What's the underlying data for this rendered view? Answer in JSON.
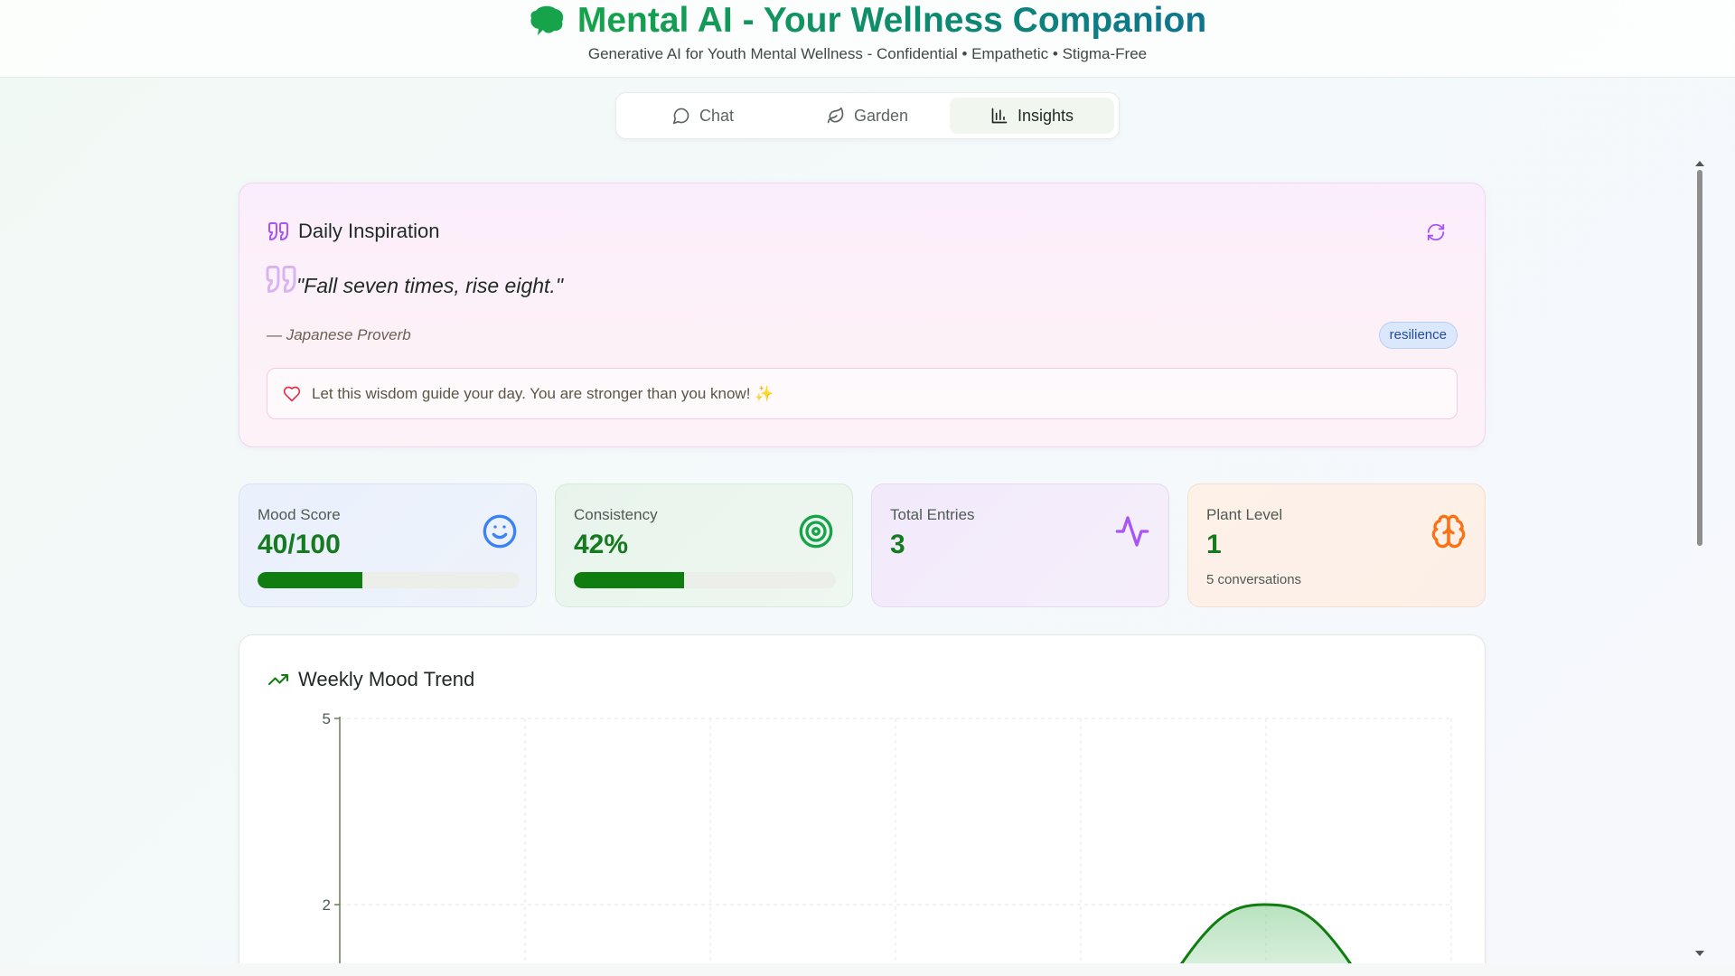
{
  "header": {
    "title": "Mental AI - Your Wellness Companion",
    "subtitle": "Generative AI for Youth Mental Wellness - Confidential • Empathetic • Stigma-Free",
    "logo_icon": "brain-icon"
  },
  "tabs": [
    {
      "label": "Chat",
      "icon": "message-circle-icon",
      "active": false
    },
    {
      "label": "Garden",
      "icon": "leaf-icon",
      "active": false
    },
    {
      "label": "Insights",
      "icon": "bar-chart-icon",
      "active": true
    }
  ],
  "inspiration": {
    "title": "Daily Inspiration",
    "quote": "\"Fall seven times, rise eight.\"",
    "author": "— Japanese Proverb",
    "tag": "resilience",
    "message": "Let this wisdom guide your day. You are stronger than you know! ✨"
  },
  "stats": {
    "mood": {
      "label": "Mood Score",
      "value": "40/100",
      "progress": 0.4
    },
    "consistency": {
      "label": "Consistency",
      "value": "42%",
      "progress": 0.42
    },
    "entries": {
      "label": "Total Entries",
      "value": "3"
    },
    "plant": {
      "label": "Plant Level",
      "value": "1",
      "note": "5 conversations"
    }
  },
  "colors": {
    "accent_green": "#0f7d0f",
    "title_gradient_start": "#16a34a",
    "title_gradient_end": "#0e7490",
    "purple": "#a855f7",
    "orange": "#f97316",
    "blue": "#3b82f6"
  },
  "chart": {
    "title": "Weekly Mood Trend"
  },
  "chart_data": {
    "type": "area",
    "title": "Weekly Mood Trend",
    "xlabel": "",
    "ylabel": "",
    "y_ticks": [
      2,
      5
    ],
    "ylim": [
      0,
      5
    ],
    "grid": true,
    "x_count": 7,
    "series": [
      {
        "values": [
          null,
          null,
          null,
          null,
          null,
          2,
          null
        ]
      }
    ]
  }
}
